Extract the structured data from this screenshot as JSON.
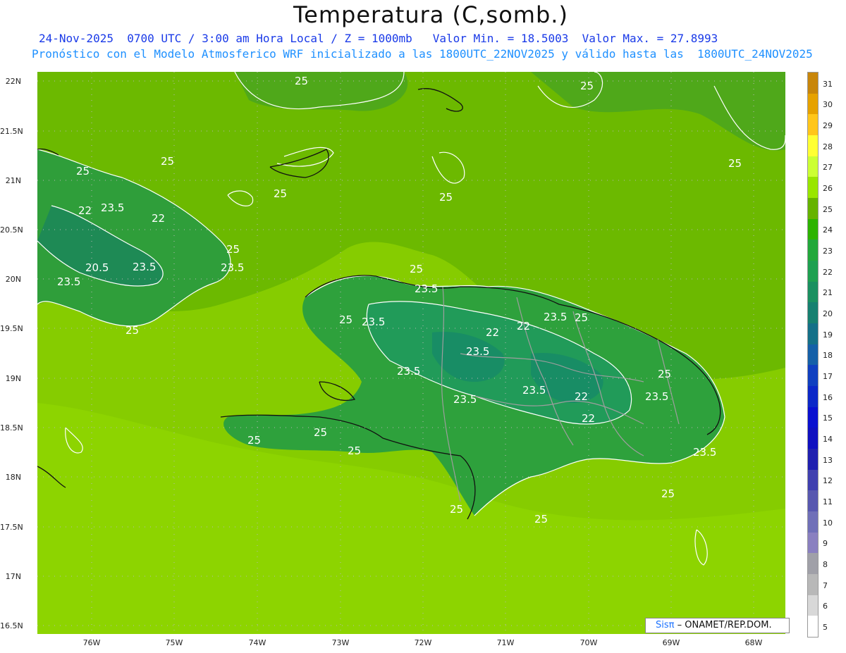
{
  "title": "Temperatura (C,somb.)",
  "subtitle_line1": "24-Nov-2025  0700 UTC / 3:00 am Hora Local / Z = 1000mb   Valor Min. = 18.5003  Valor Max. = 27.8993",
  "subtitle_line2": "Pronóstico con el Modelo Atmosferico WRF inicializado a las 1800UTC_22NOV2025 y válido hasta las  1800UTC_24NOV2025",
  "credit": {
    "brand": "Sisπ",
    "text": " – ONAMET/REP.DOM."
  },
  "lat_labels": [
    "22N",
    "21.5N",
    "21N",
    "20.5N",
    "20N",
    "19.5N",
    "19N",
    "18.5N",
    "18N",
    "17.5N",
    "17N",
    "16.5N"
  ],
  "lon_labels": [
    "76W",
    "75W",
    "74W",
    "73W",
    "72W",
    "71W",
    "70W",
    "69W",
    "68W"
  ],
  "contour_labels": [
    "25",
    "23.5",
    "22",
    "20.5"
  ],
  "colorbar": {
    "labels": [
      "31",
      "30",
      "29",
      "28",
      "27",
      "26",
      "25",
      "24",
      "23",
      "22",
      "21",
      "20",
      "19",
      "18",
      "17",
      "16",
      "15",
      "14",
      "13",
      "12",
      "11",
      "10",
      "9",
      "8",
      "7",
      "6",
      "5"
    ],
    "colors": [
      "#c8860a",
      "#e6a200",
      "#ffc61a",
      "#ffff33",
      "#ccff33",
      "#99e600",
      "#66b300",
      "#2db300",
      "#22a83a",
      "#1ea050",
      "#1a9060",
      "#168070",
      "#147088",
      "#1560a8",
      "#1040c0",
      "#0c28c8",
      "#0a10d0",
      "#1010c0",
      "#2020b0",
      "#4040b0",
      "#5858b0",
      "#7070b8",
      "#8a80c0",
      "#a0a0a8",
      "#b8b8b8",
      "#d8d8d8",
      "#ffffff"
    ]
  },
  "colors": {
    "sea": "#6cb900",
    "sea_warm": "#8fd400",
    "land_cool": "#2fa13c",
    "land_mid": "#40aa30",
    "contour": "#ffffff",
    "coast": "#111111",
    "border": "#999999"
  }
}
